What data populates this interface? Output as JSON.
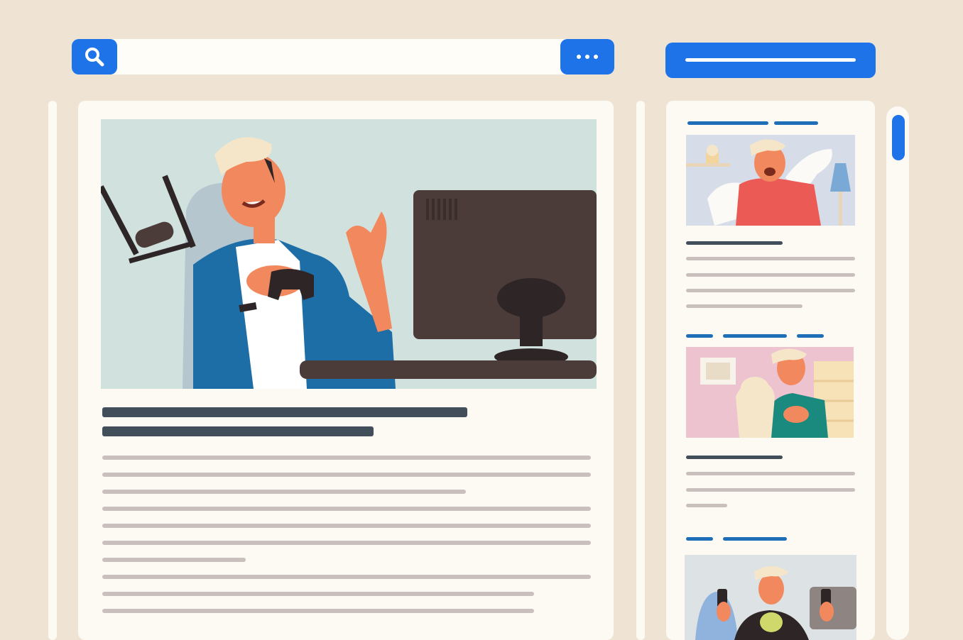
{
  "search": {
    "value": "",
    "placeholder": ""
  },
  "icons": {
    "search": "search-icon",
    "more": "more-horizontal-icon",
    "scroll": "scroll-thumb"
  },
  "colors": {
    "background": "#efe3d4",
    "panel": "#fdfaf3",
    "accent": "#1e73e8",
    "title_placeholder": "#424e5a",
    "text_placeholder": "#c9bfbc",
    "tag_placeholder": "#1f6fb8"
  },
  "main": {
    "hero_image": "man-gaming-with-controller-illustration"
  },
  "sidebar": {
    "cards": [
      {
        "image": "man-celebrating-illustration"
      },
      {
        "image": "man-holding-cat-illustration"
      },
      {
        "image": "man-with-controllers-illustration"
      }
    ]
  }
}
